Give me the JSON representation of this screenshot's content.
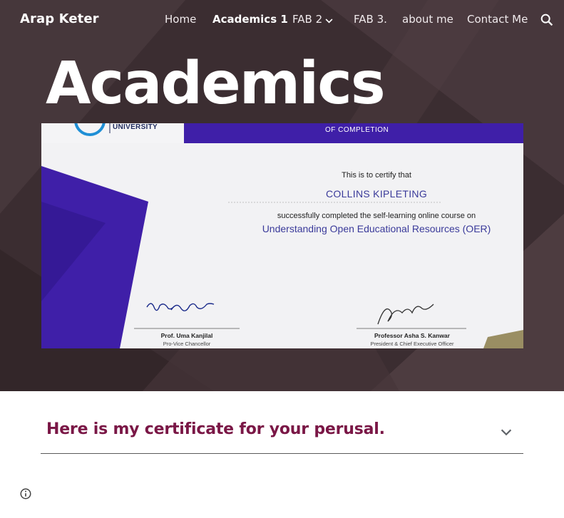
{
  "site": {
    "title": "Arap Keter"
  },
  "nav": {
    "items": [
      {
        "label": "Home"
      },
      {
        "label": "Academics 1"
      },
      {
        "label": "FAB 2"
      },
      {
        "label": "FAB 3."
      },
      {
        "label": "about me"
      },
      {
        "label": "Contact Me"
      }
    ],
    "search_icon": "search-icon"
  },
  "page": {
    "title": "Academics"
  },
  "certificate": {
    "university": "UNIVERSITY",
    "of_completion": "OF COMPLETION",
    "certify": "This is to certify that",
    "name": "COLLINS KIPLETING",
    "completed_line": "successfully completed the self-learning online course on",
    "course": "Understanding Open Educational Resources (OER)",
    "signatory_left": {
      "name": "Prof. Uma Kanjilal",
      "role": "Pro-Vice Chancellor"
    },
    "signatory_right": {
      "name": "Professor Asha S. Kanwar",
      "role": "President & Chief Executive Officer"
    },
    "accent_color": "#3f1fa8"
  },
  "section": {
    "heading": "Here is my certificate for your perusal.",
    "heading_color": "#7a1746"
  },
  "colors": {
    "hero_bg": "#3d2f33"
  }
}
